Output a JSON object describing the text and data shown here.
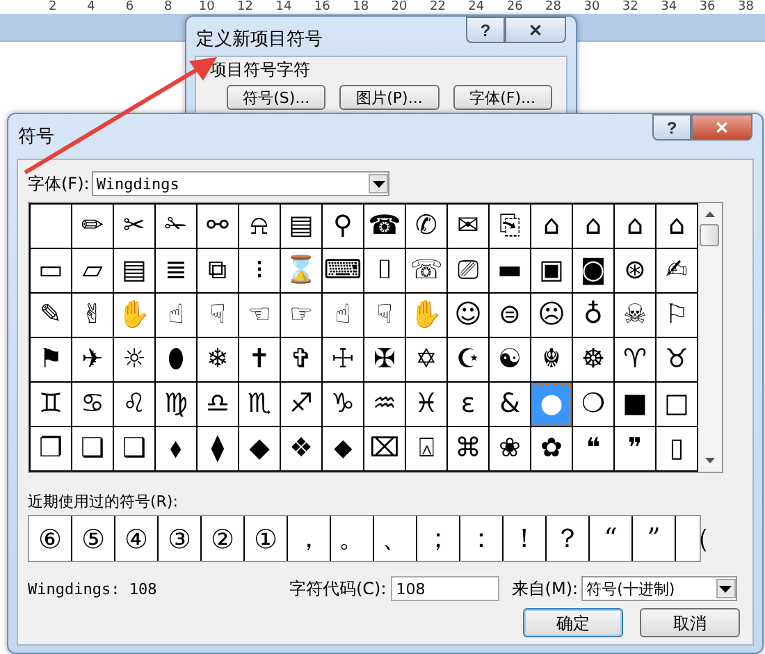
{
  "ruler": {
    "ticks": [
      "2",
      "4",
      "6",
      "8",
      "10",
      "12",
      "14",
      "16",
      "18",
      "20",
      "22",
      "24",
      "26",
      "28",
      "30",
      "32",
      "34",
      "36",
      "38"
    ]
  },
  "bullet_dialog": {
    "title": "定义新项目符号",
    "help": "?",
    "close": "✕",
    "group_label": "项目符号字符",
    "buttons": [
      "符号(S)...",
      "图片(P)...",
      "字体(F)..."
    ]
  },
  "symbol_dialog": {
    "title": "符号",
    "help": "?",
    "close": "✕",
    "font_label": "字体(F):",
    "font_value": "Wingdings",
    "symbols": [
      {
        "selected": false
      },
      {
        "symbol": "✏",
        "selected": false
      },
      {
        "symbol": "✂",
        "selected": false
      },
      {
        "symbol": "✁",
        "selected": false
      },
      {
        "symbol": "⚯",
        "selected": false
      },
      {
        "symbol": "⍾",
        "selected": false
      },
      {
        "symbol": "▤",
        "selected": false
      },
      {
        "symbol": "⚲",
        "selected": false
      },
      {
        "symbol": "☎",
        "selected": false
      },
      {
        "symbol": "✆",
        "selected": false
      },
      {
        "symbol": "✉",
        "selected": false
      },
      {
        "symbol": "⎘",
        "selected": false
      },
      {
        "symbol": "⌂",
        "selected": false
      },
      {
        "symbol": "⌂",
        "selected": false
      },
      {
        "symbol": "⌂",
        "selected": false
      },
      {
        "symbol": "⌂",
        "selected": false
      },
      {
        "symbol": "▭",
        "selected": false
      },
      {
        "symbol": "▱",
        "selected": false
      },
      {
        "symbol": "▤",
        "selected": false
      },
      {
        "symbol": "≣",
        "selected": false
      },
      {
        "symbol": "⧉",
        "selected": false
      },
      {
        "symbol": "⁝",
        "selected": false
      },
      {
        "symbol": "⌛",
        "selected": false
      },
      {
        "symbol": "⌨",
        "selected": false
      },
      {
        "symbol": "⌷",
        "selected": false
      },
      {
        "symbol": "☏",
        "selected": false
      },
      {
        "symbol": "⎚",
        "selected": false
      },
      {
        "symbol": "▬",
        "selected": false
      },
      {
        "symbol": "▣",
        "selected": false
      },
      {
        "symbol": "◙",
        "selected": false
      },
      {
        "symbol": "⊛",
        "selected": false
      },
      {
        "symbol": "✍",
        "selected": false
      },
      {
        "symbol": "✎",
        "selected": false
      },
      {
        "symbol": "✌",
        "selected": false
      },
      {
        "symbol": "✋",
        "selected": false
      },
      {
        "symbol": "☝",
        "selected": false
      },
      {
        "symbol": "☟",
        "selected": false
      },
      {
        "symbol": "☜",
        "selected": false
      },
      {
        "symbol": "☞",
        "selected": false
      },
      {
        "symbol": "☝",
        "selected": false
      },
      {
        "symbol": "☟",
        "selected": false
      },
      {
        "symbol": "✋",
        "selected": false
      },
      {
        "symbol": "☺",
        "selected": false
      },
      {
        "symbol": "⊜",
        "selected": false
      },
      {
        "symbol": "☹",
        "selected": false
      },
      {
        "symbol": "♁",
        "selected": false
      },
      {
        "symbol": "☠",
        "selected": false
      },
      {
        "symbol": "⚐",
        "selected": false
      },
      {
        "symbol": "⚑",
        "selected": false
      },
      {
        "symbol": "✈",
        "selected": false
      },
      {
        "symbol": "☼",
        "selected": false
      },
      {
        "symbol": "⬮",
        "selected": false
      },
      {
        "symbol": "❄",
        "selected": false
      },
      {
        "symbol": "✝",
        "selected": false
      },
      {
        "symbol": "✞",
        "selected": false
      },
      {
        "symbol": "☩",
        "selected": false
      },
      {
        "symbol": "✠",
        "selected": false
      },
      {
        "symbol": "✡",
        "selected": false
      },
      {
        "symbol": "☪",
        "selected": false
      },
      {
        "symbol": "☯",
        "selected": false
      },
      {
        "symbol": "☬",
        "selected": false
      },
      {
        "symbol": "☸",
        "selected": false
      },
      {
        "symbol": "♈",
        "selected": false
      },
      {
        "symbol": "♉",
        "selected": false
      },
      {
        "symbol": "♊",
        "selected": false
      },
      {
        "symbol": "♋",
        "selected": false
      },
      {
        "symbol": "♌",
        "selected": false
      },
      {
        "symbol": "♍",
        "selected": false
      },
      {
        "symbol": "♎",
        "selected": false
      },
      {
        "symbol": "♏",
        "selected": false
      },
      {
        "symbol": "♐",
        "selected": false
      },
      {
        "symbol": "♑",
        "selected": false
      },
      {
        "symbol": "♒",
        "selected": false
      },
      {
        "symbol": "♓",
        "selected": false
      },
      {
        "symbol": "ε",
        "selected": false
      },
      {
        "symbol": "&",
        "selected": false
      },
      {
        "symbol": "●",
        "selected": true
      },
      {
        "symbol": "❍",
        "selected": false
      },
      {
        "symbol": "■",
        "selected": false
      },
      {
        "symbol": "□",
        "selected": false
      },
      {
        "symbol": "❐",
        "selected": false
      },
      {
        "symbol": "❏",
        "selected": false
      },
      {
        "symbol": "❑",
        "selected": false
      },
      {
        "symbol": "⬧",
        "selected": false
      },
      {
        "symbol": "⧫",
        "selected": false
      },
      {
        "symbol": "◆",
        "selected": false
      },
      {
        "symbol": "❖",
        "selected": false
      },
      {
        "symbol": "⬥",
        "selected": false
      },
      {
        "symbol": "⌧",
        "selected": false
      },
      {
        "symbol": "⍓",
        "selected": false
      },
      {
        "symbol": "⌘",
        "selected": false
      },
      {
        "symbol": "❀",
        "selected": false
      },
      {
        "symbol": "✿",
        "selected": false
      },
      {
        "symbol": "❝",
        "selected": false
      },
      {
        "symbol": "❞",
        "selected": false
      },
      {
        "symbol": "▯",
        "selected": false
      }
    ],
    "recent_label": "近期使用过的符号(R):",
    "recent_symbols": [
      "⑥",
      "⑤",
      "④",
      "③",
      "②",
      "①",
      "，",
      "。",
      "、",
      "；",
      "：",
      "！",
      "？",
      "“",
      "”",
      "（"
    ],
    "status": "Wingdings: 108",
    "code_label": "字符代码(C):",
    "code_value": "108",
    "from_label": "来自(M):",
    "from_value": "符号(十进制)",
    "ok": "确定",
    "cancel": "取消"
  }
}
